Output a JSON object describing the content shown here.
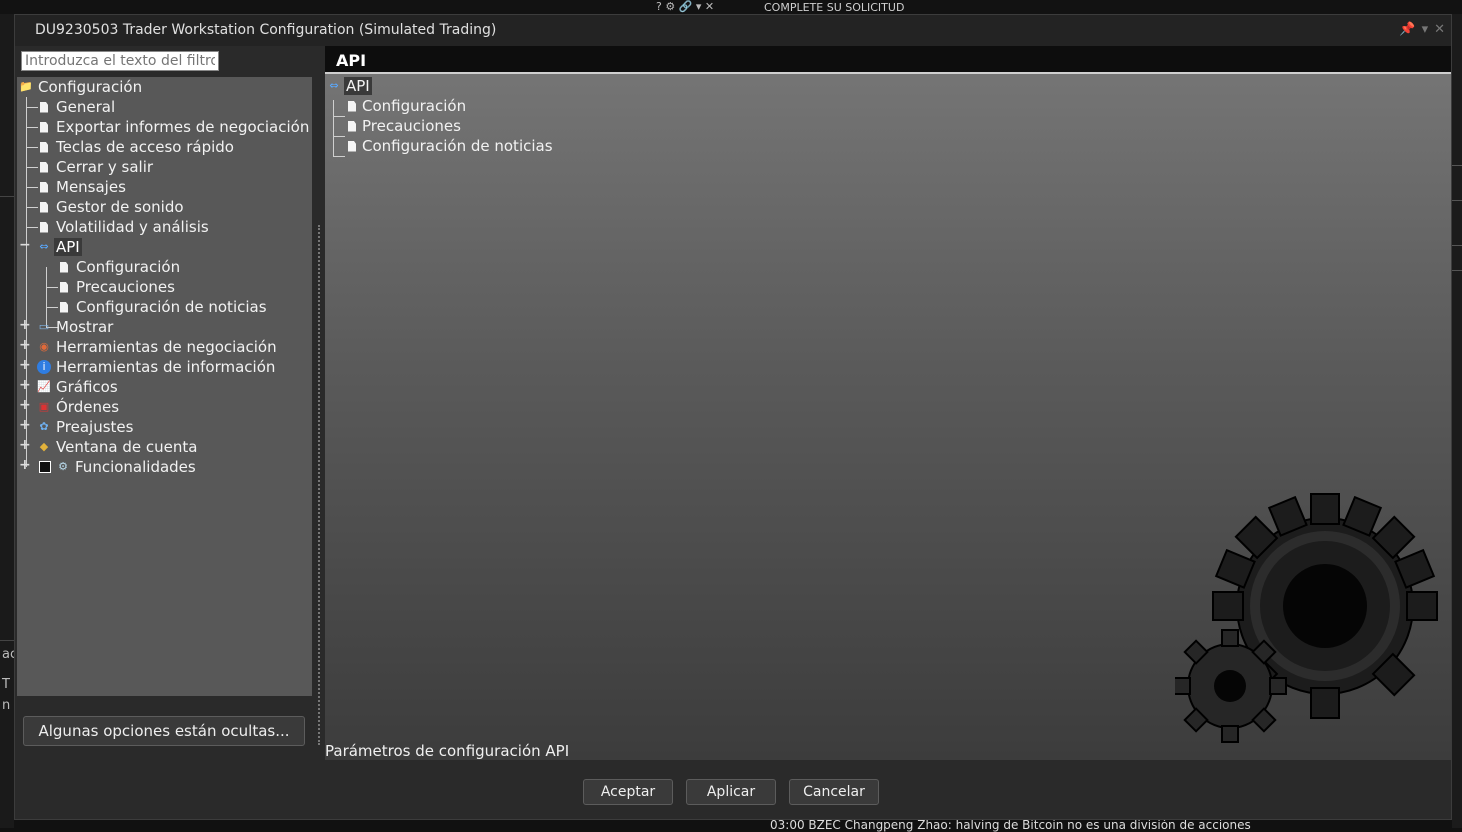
{
  "background": {
    "top_text": "COMPLETE SU SOLICITUD",
    "top_icons": "? ⚙ 🔗 ▾ ✕",
    "bottom_text": "03:00 BZEC Changpeng Zhao: halving de Bitcoin no es una división de acciones",
    "left_fragments": [
      "ac",
      "T",
      "n"
    ]
  },
  "dialog": {
    "title": "DU9230503 Trader Workstation Configuration (Simulated Trading)",
    "filter_placeholder": "Introduzca el texto del filtro",
    "hidden_options_button": "Algunas opciones están ocultas...",
    "buttons": {
      "ok": "Aceptar",
      "apply": "Aplicar",
      "cancel": "Cancelar"
    }
  },
  "tree": {
    "root": "Configuración",
    "items": [
      "General",
      "Exportar informes de negociación",
      "Teclas de acceso rápido",
      "Cerrar y salir",
      "Mensajes",
      "Gestor de sonido",
      "Volatilidad y análisis"
    ],
    "api": {
      "label": "API",
      "children": [
        "Configuración",
        "Precauciones",
        "Configuración de noticias"
      ]
    },
    "groups": [
      "Mostrar",
      "Herramientas de negociación",
      "Herramientas de información",
      "Gráficos",
      "Órdenes",
      "Preajustes",
      "Ventana de cuenta",
      "Funcionalidades"
    ]
  },
  "panel": {
    "header": "API",
    "root": "API",
    "children": [
      "Configuración",
      "Precauciones",
      "Configuración de noticias"
    ],
    "footer": "Parámetros de configuración API"
  }
}
